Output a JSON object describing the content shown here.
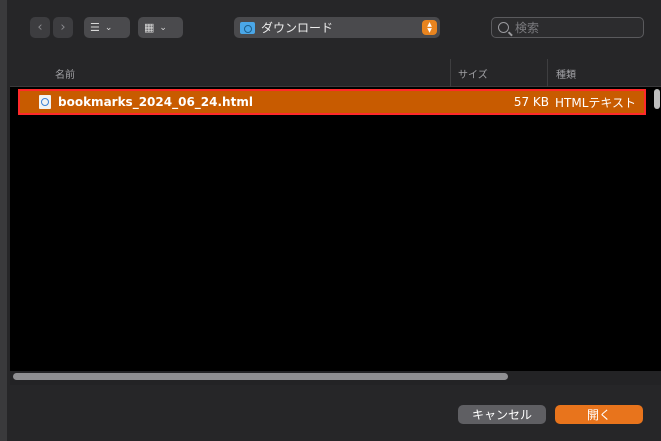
{
  "toolbar": {
    "back_glyph": "‹",
    "forward_glyph": "›",
    "list_view_glyph": "☰",
    "grid_view_glyph": "▦",
    "chevron_glyph": "⌄",
    "location": "ダウンロード",
    "search_placeholder": "検索"
  },
  "columns": {
    "name": "名前",
    "size": "サイズ",
    "kind": "種類"
  },
  "files": [
    {
      "name": "bookmarks_2024_06_24.html",
      "size": "57 KB",
      "kind": "HTMLテキスト",
      "selected": true
    }
  ],
  "buttons": {
    "cancel": "キャンセル",
    "open": "開く"
  },
  "colors": {
    "selection": "#c85b00",
    "accent": "#e8741c",
    "highlight_border": "#ff2a2a"
  }
}
